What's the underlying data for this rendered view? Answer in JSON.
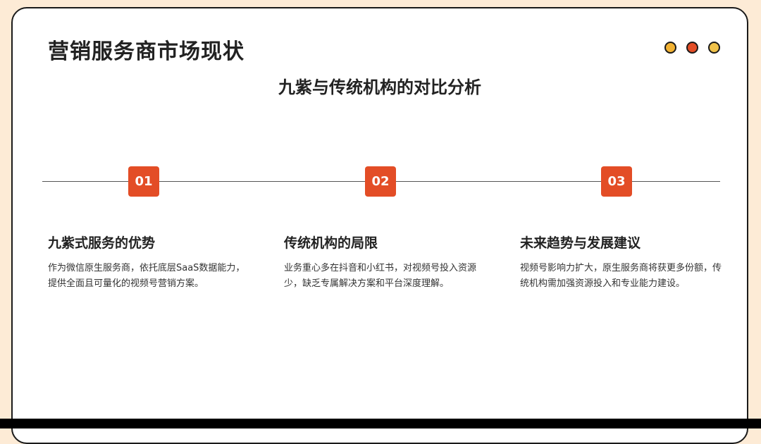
{
  "header": {
    "title": "营销服务商市场现状"
  },
  "window_controls": [
    {
      "name": "yellow-dot",
      "color": "#f2b233"
    },
    {
      "name": "red-dot",
      "color": "#e34d26"
    },
    {
      "name": "yellow-dot-2",
      "color": "#f0c24a"
    }
  ],
  "subtitle": "九紫与传统机构的对比分析",
  "theme": {
    "accent": "#e34d26",
    "background": "#fdebd6",
    "card": "#ffffff"
  },
  "steps": [
    {
      "number": "01",
      "title": "九紫式服务的优势",
      "text": "作为微信原生服务商，依托底层SaaS数据能力，提供全面且可量化的视频号营销方案。"
    },
    {
      "number": "02",
      "title": "传统机构的局限",
      "text": "业务重心多在抖音和小红书，对视频号投入资源少，缺乏专属解决方案和平台深度理解。"
    },
    {
      "number": "03",
      "title": "未来趋势与发展建议",
      "text": "视频号影响力扩大，原生服务商将获更多份额，传统机构需加强资源投入和专业能力建设。"
    }
  ]
}
